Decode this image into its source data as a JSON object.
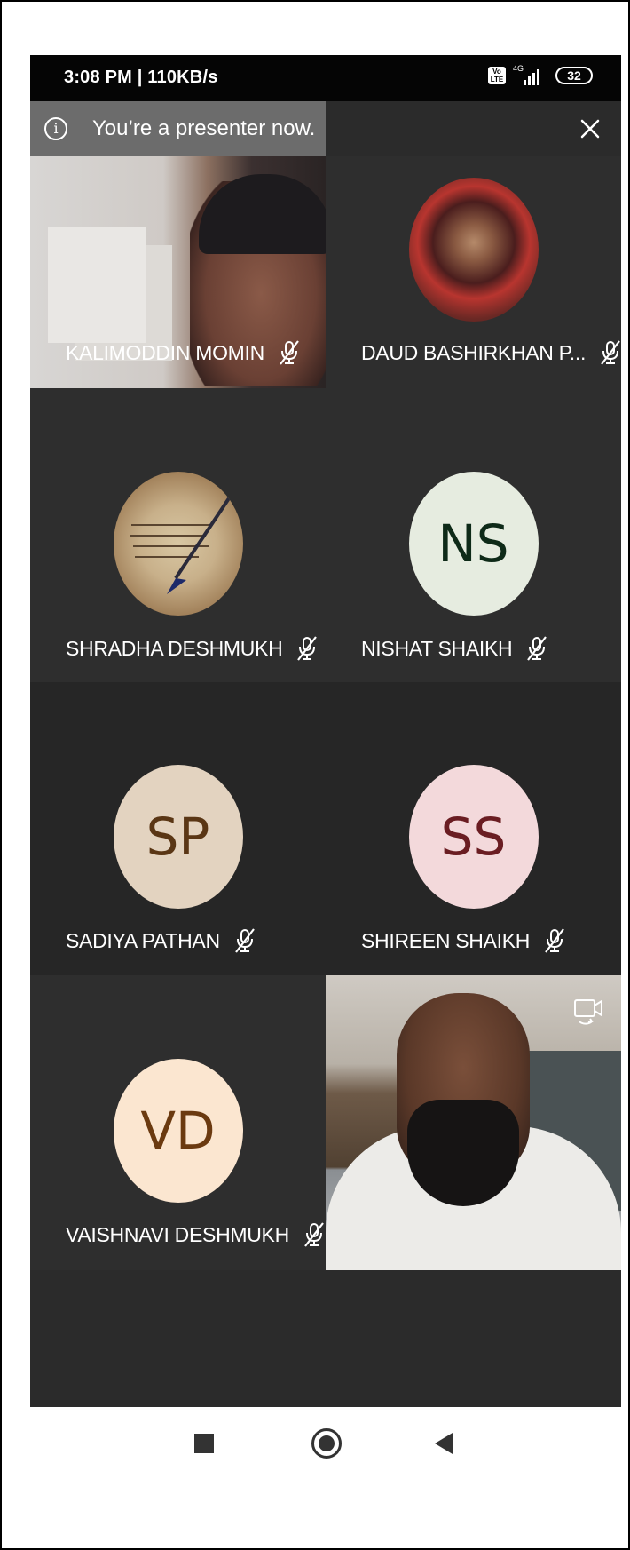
{
  "status_bar": {
    "time": "3:08 PM | 110KB/s",
    "network_type": "4G",
    "battery": "32"
  },
  "banner": {
    "text": "You’re a presenter now."
  },
  "participants": [
    {
      "name": "KALIMODDIN MOMIN",
      "muted": true,
      "type": "video"
    },
    {
      "name": "DAUD BASHIRKHAN P...",
      "muted": true,
      "type": "photo"
    },
    {
      "name": "SHRADHA DESHMUKH",
      "muted": true,
      "type": "photo"
    },
    {
      "name": "NISHAT SHAIKH",
      "muted": true,
      "type": "initials",
      "initials": "NS",
      "avatar_bg": "#e6ece0",
      "avatar_fg": "#0e2a18"
    },
    {
      "name": "SADIYA PATHAN",
      "muted": true,
      "type": "initials",
      "initials": "SP",
      "avatar_bg": "#e3d3c0",
      "avatar_fg": "#5a3615"
    },
    {
      "name": "SHIREEN SHAIKH",
      "muted": true,
      "type": "initials",
      "initials": "SS",
      "avatar_bg": "#f3d9db",
      "avatar_fg": "#6a1d22"
    },
    {
      "name": "VAISHNAVI DESHMUKH",
      "muted": true,
      "type": "initials",
      "initials": "VD",
      "avatar_bg": "#fbe6d0",
      "avatar_fg": "#6b3a10"
    },
    {
      "name": "",
      "type": "self-video"
    }
  ],
  "colors": {
    "tile_dark": "#2e2e2e",
    "banner_bg": "#6c6c6c",
    "status_bg": "#050505"
  },
  "icons": {
    "mic_off": "mic-off-icon",
    "close": "close-icon",
    "info": "info-icon",
    "switch_camera": "switch-camera-icon"
  }
}
